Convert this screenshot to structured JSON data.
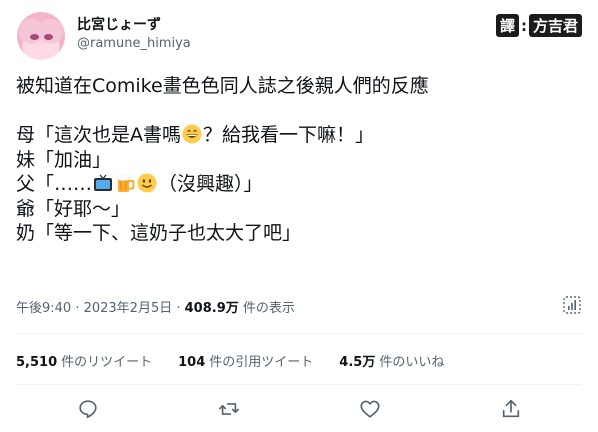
{
  "author": {
    "display_name": "比宮じょーず",
    "handle": "@ramune_himiya"
  },
  "translation_badge": {
    "prefix": "譯",
    "separator": ":",
    "name": "方吉君"
  },
  "tweet": {
    "line1": "被知道在Comike畫色色同人誌之後親人們的反應",
    "line2_a": "母「這次也是A書嗎",
    "line2_b": "？給我看一下嘛！」",
    "line3": "妹「加油」",
    "line4_a": "父「……",
    "line4_b": "（沒興趣）」",
    "line5": "爺「好耶～」",
    "line6": "奶「等一下、這奶子也太大了吧」",
    "emoji_names": [
      "grinning-face-icon",
      "television-icon",
      "beer-mug-icon",
      "slightly-smiling-face-icon"
    ]
  },
  "meta": {
    "time_date": "午後9:40 · 2023年2月5日 · ",
    "views_count": "408.9万",
    "views_label": " 件の表示"
  },
  "stats": {
    "retweets_count": "5,510",
    "retweets_label": "件のリツイート",
    "quotes_count": "104",
    "quotes_label": "件の引用ツイート",
    "likes_count": "4.5万",
    "likes_label": "件のいいね"
  },
  "colors": {
    "text": "#0f1419",
    "secondary": "#536471",
    "divider": "#eff3f4"
  }
}
